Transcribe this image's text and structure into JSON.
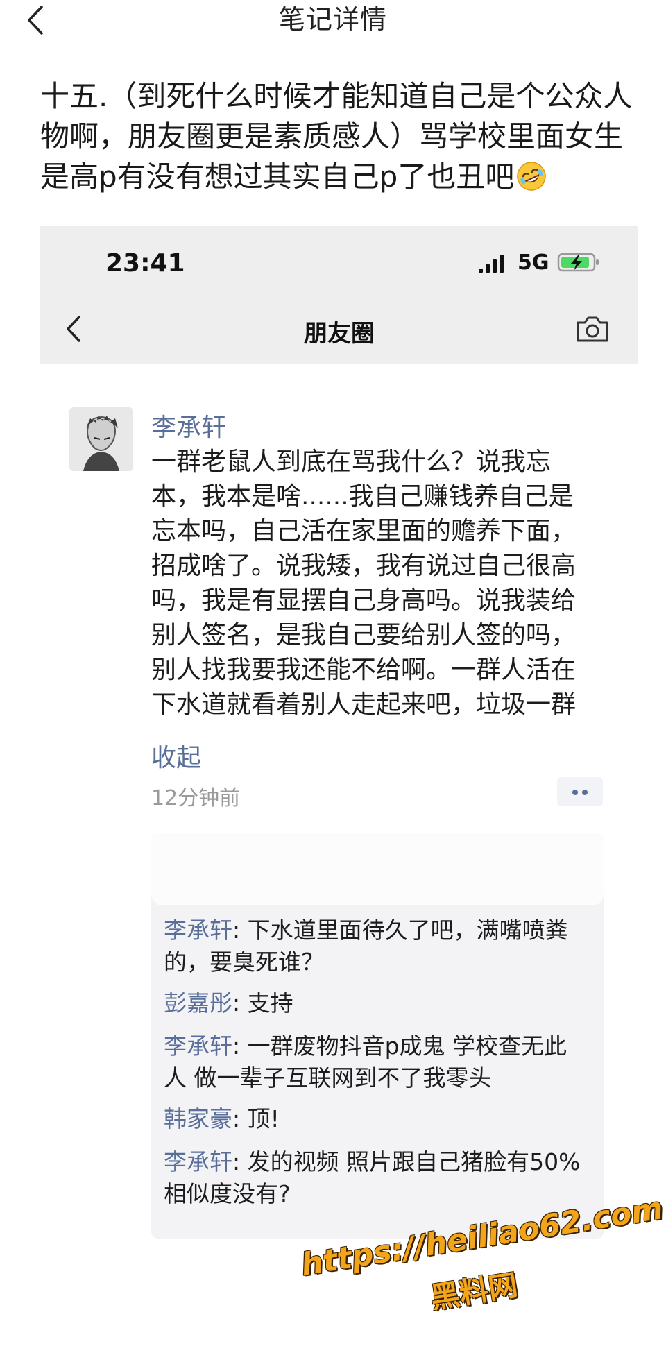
{
  "header": {
    "title": "笔记详情",
    "back_icon": "chevron-left-icon"
  },
  "note": {
    "text": "十五.（到死什么时候才能知道自己是个公众人物啊，朋友圈更是素质感人）骂学校里面女生是高p有没有想过其实自己p了也丑吧",
    "emoji": "rolling-on-floor-laughing-icon"
  },
  "screenshot": {
    "status_bar": {
      "time": "23:41",
      "network": "5G",
      "signal_icon": "signal-bars-icon",
      "battery_icon": "battery-charging-icon"
    },
    "nav": {
      "title": "朋友圈",
      "back_icon": "chevron-left-icon",
      "camera_icon": "camera-icon"
    },
    "post": {
      "author": "李承轩",
      "body_lines": [
        "一群老鼠人到底在骂我什么？说我忘",
        "本，我本是啥......我自己赚钱养自己是",
        "忘本吗，自己活在家里面的赡养下面，",
        "招成啥了。说我矮，我有说过自己很高",
        "吗，我是有显摆自己身高吗。说我装给",
        "别人签名，是我自己要给别人签的吗，",
        "别人找我要我还能不给啊。一群人活在",
        "下水道就看着别人走起来吧，垃圾一群"
      ],
      "collapse_label": "收起",
      "timestamp": "12分钟前"
    },
    "comments": [
      {
        "name": "李承轩",
        "sep": ": ",
        "lines": [
          "下水道里面待久了吧，满嘴喷粪",
          "的，要臭死谁？"
        ]
      },
      {
        "name": "彭嘉彤",
        "sep": ": ",
        "lines": [
          "支持"
        ]
      },
      {
        "name": "李承轩",
        "sep": ": ",
        "lines": [
          "一群废物抖音p成鬼 学校查无此",
          "人 做一辈子互联网到不了我零头"
        ]
      },
      {
        "name": "韩家豪",
        "sep": ": ",
        "lines": [
          "顶!"
        ]
      },
      {
        "name": "李承轩",
        "sep": ": ",
        "lines": [
          "发的视频 照片跟自己猪脸有50%",
          "相似度没有?"
        ]
      }
    ]
  },
  "watermark": {
    "url": "https://heiliao62.com",
    "name": "黑料网"
  }
}
